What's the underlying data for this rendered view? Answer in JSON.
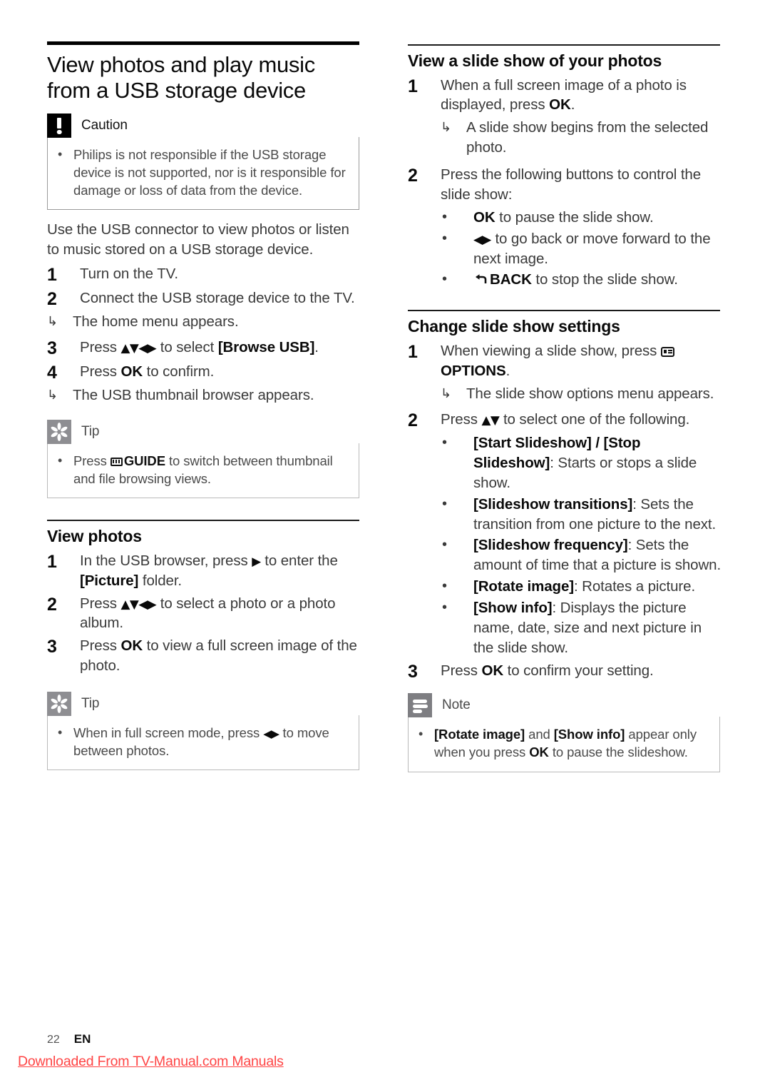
{
  "document": {
    "page_number": "22",
    "language_code": "EN",
    "watermark": "Downloaded From TV-Manual.com Manuals"
  },
  "left_column": {
    "chapter_title": "View photos and play music from a USB storage device",
    "caution": {
      "icon": "caution-icon",
      "title": "Caution",
      "bullet": "Philips is not responsible if the USB storage device is not supported, nor is it responsible for damage or loss of data from the device."
    },
    "intro": "Use the USB connector to view photos or listen to music stored on a USB storage device.",
    "steps": [
      {
        "num": "1",
        "text": "Turn on the TV."
      },
      {
        "num": "2",
        "text": "Connect the USB storage device to the TV.",
        "result": "The home menu appears."
      },
      {
        "num": "3",
        "text_pre": "Press ",
        "glyph": "▲▼◀▶",
        "text_mid": " to select ",
        "bold": "[Browse USB]",
        "text_post": "."
      },
      {
        "num": "4",
        "text_pre": "Press ",
        "bold": "OK",
        "text_post": " to confirm.",
        "result": "The USB thumbnail browser appears."
      }
    ],
    "tip1": {
      "icon": "tip-icon",
      "title": "Tip",
      "bullet_pre": "Press ",
      "bullet_icon": "guide-button-icon",
      "bullet_bold": "GUIDE",
      "bullet_post": " to switch between thumbnail and file browsing views."
    },
    "view_photos": {
      "heading": "View photos",
      "steps": [
        {
          "num": "1",
          "text_pre": "In the USB browser, press ",
          "glyph": "▶",
          "text_mid": " to enter the ",
          "bold": "[Picture]",
          "text_post": " folder."
        },
        {
          "num": "2",
          "text_pre": "Press ",
          "glyph": "▲▼◀▶",
          "text_post": " to select a photo or a photo album."
        },
        {
          "num": "3",
          "text_pre": "Press ",
          "bold": "OK",
          "text_post": " to view a full screen image of the photo."
        }
      ]
    },
    "tip2": {
      "icon": "tip-icon",
      "title": "Tip",
      "bullet_pre": "When in full screen mode, press ",
      "bullet_glyph": "◀▶",
      "bullet_post": " to move between photos."
    }
  },
  "right_column": {
    "slideshow": {
      "heading": "View a slide show of your photos",
      "step1": {
        "num": "1",
        "text_pre": "When a full screen image of a photo is displayed, press ",
        "bold": "OK",
        "text_post": ".",
        "result": "A slide show begins from the selected photo."
      },
      "step2": {
        "num": "2",
        "text": "Press the following buttons to control the slide show:",
        "bullets": [
          {
            "bold": "OK",
            "text": " to pause the slide show."
          },
          {
            "glyph": "◀▶",
            "text": " to go back or move forward to the next image."
          },
          {
            "icon": "back-button-icon",
            "bold": "BACK",
            "text": " to stop the slide show."
          }
        ]
      }
    },
    "settings": {
      "heading": "Change slide show settings",
      "step1": {
        "num": "1",
        "text_pre": "When viewing a slide show, press ",
        "icon": "options-button-icon",
        "bold": "OPTIONS",
        "text_post": ".",
        "result": "The slide show options menu appears."
      },
      "step2": {
        "num": "2",
        "text_pre": "Press ",
        "glyph": "▲▼",
        "text_post": " to select one of the following.",
        "options": [
          {
            "bold": "[Start Slideshow] / [Stop Slideshow]",
            "text": ": Starts or stops a slide show."
          },
          {
            "bold": "[Slideshow transitions]",
            "text": ": Sets the transition from one picture to the next."
          },
          {
            "bold": "[Slideshow frequency]",
            "text": ": Sets the amount of time that a picture is shown."
          },
          {
            "bold": "[Rotate image]",
            "text": ": Rotates a picture."
          },
          {
            "bold": "[Show info]",
            "text": ": Displays the picture name, date, size and next picture in the slide show."
          }
        ]
      },
      "step3": {
        "num": "3",
        "text_pre": "Press ",
        "bold": "OK",
        "text_post": " to confirm your setting."
      }
    },
    "note": {
      "icon": "note-icon",
      "title": "Note",
      "bullet_b1": "[Rotate image]",
      "bullet_t1": " and ",
      "bullet_b2": "[Show info]",
      "bullet_t2": " appear only when you press ",
      "bullet_b3": "OK",
      "bullet_t3": " to pause the slideshow."
    }
  },
  "colors": {
    "caution_icon_bg": "#000000",
    "tip_icon_bg": "#8e8e92",
    "note_icon_bg": "#7e7e82",
    "body_text": "#3a3a3a",
    "watermark": "#ff4444"
  }
}
